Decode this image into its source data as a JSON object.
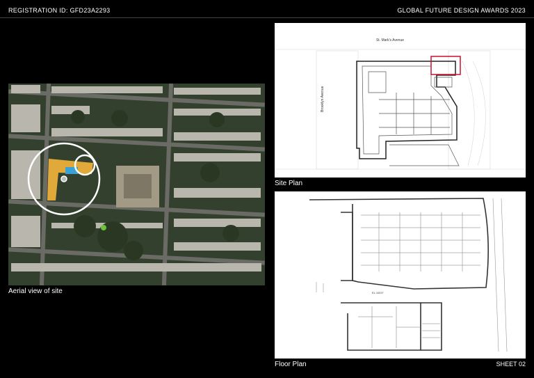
{
  "header": {
    "registration": "REGISTRATION ID:  GFD23A2293",
    "event": "GLOBAL FUTURE DESIGN AWARDS 2023"
  },
  "aerial": {
    "caption": "Aerial view of site"
  },
  "site_plan": {
    "caption": "Site Plan",
    "street_top": "St. Mark's Avenue",
    "street_left": "Brooklyn Avenue"
  },
  "floor_plan": {
    "caption": "Floor Plan",
    "room_tag": "EL 100'0\""
  },
  "footer": {
    "sheet": "SHEET 02"
  }
}
